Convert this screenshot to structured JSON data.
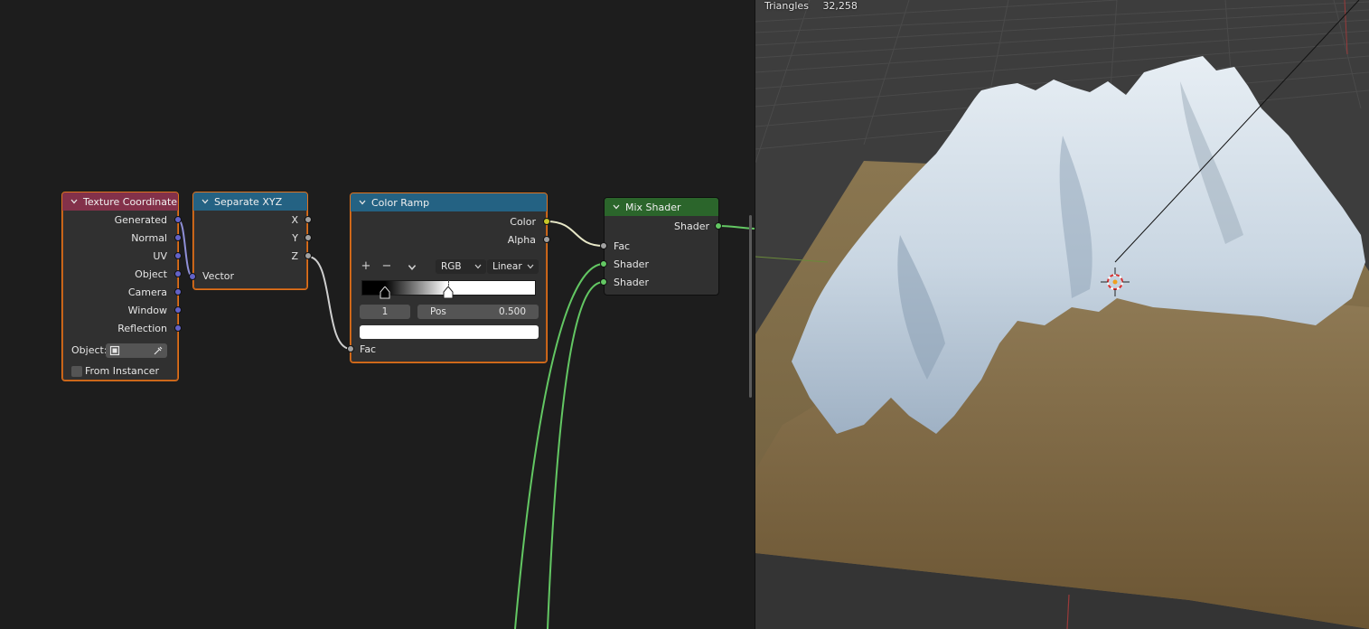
{
  "nodes": {
    "texture_coordinate": {
      "title": "Texture Coordinate",
      "outputs": [
        "Generated",
        "Normal",
        "UV",
        "Object",
        "Camera",
        "Window",
        "Reflection"
      ],
      "object_label": "Object:",
      "from_instancer_label": "From Instancer"
    },
    "separate_xyz": {
      "title": "Separate XYZ",
      "outputs": [
        "X",
        "Y",
        "Z"
      ],
      "input_label": "Vector"
    },
    "color_ramp": {
      "title": "Color Ramp",
      "outputs": [
        "Color",
        "Alpha"
      ],
      "add_label": "+",
      "remove_label": "−",
      "color_mode": "RGB",
      "interpolation": "Linear",
      "active_index": "1",
      "pos_label": "Pos",
      "pos_value": "0.500",
      "input_label": "Fac"
    },
    "mix_shader": {
      "title": "Mix Shader",
      "output_label": "Shader",
      "inputs": [
        "Fac",
        "Shader",
        "Shader"
      ]
    }
  },
  "viewport": {
    "stats_label": "Triangles",
    "stats_value": "32,258"
  },
  "colors": {
    "input_header": "#83314a",
    "converter_header": "#246283",
    "shader_header": "#2b652b",
    "selected_outline": "#e0731f",
    "vector_socket": "#6363c7",
    "float_socket": "#a1a1a1",
    "color_socket": "#c7c729",
    "shader_socket": "#63c763"
  }
}
